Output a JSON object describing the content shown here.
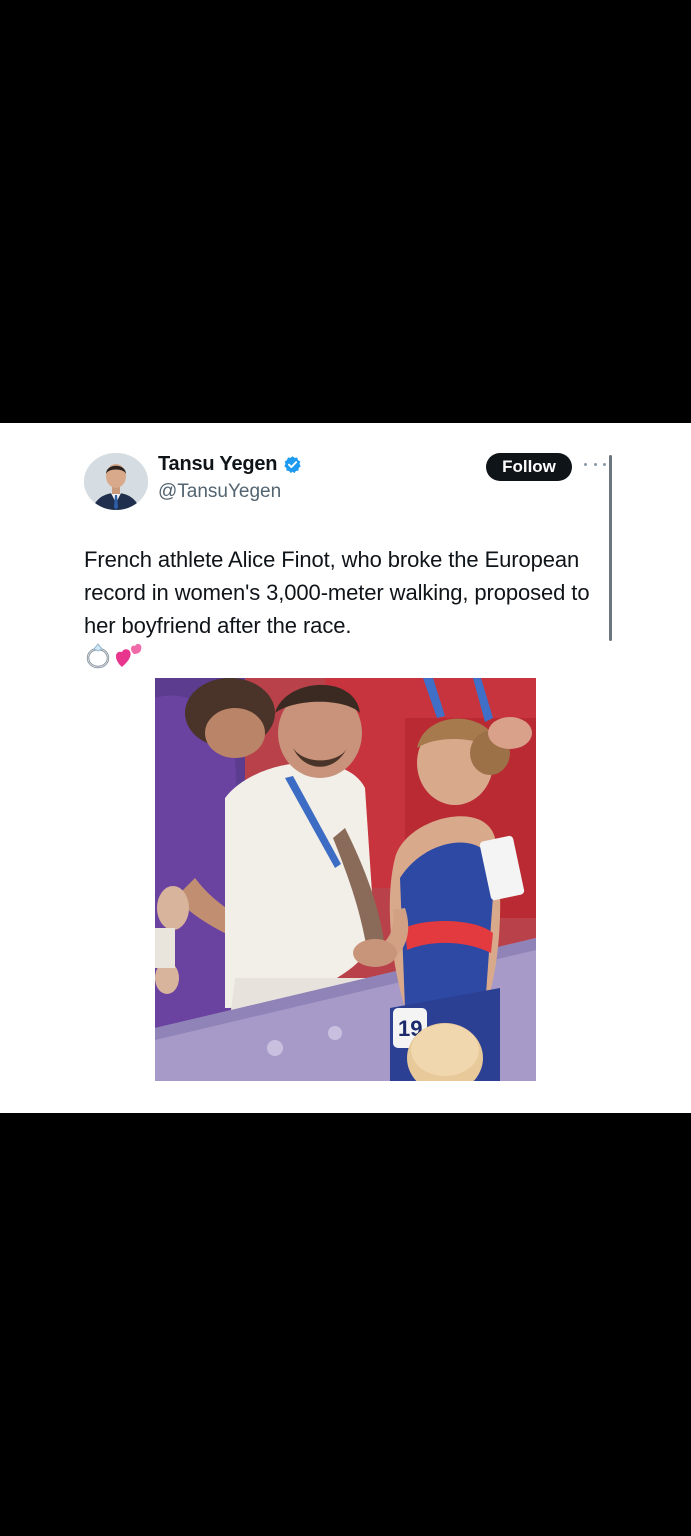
{
  "tweet": {
    "author": {
      "display_name": "Tansu Yegen",
      "handle": "@TansuYegen",
      "verified": true
    },
    "follow_label": "Follow",
    "text": "French athlete Alice Finot, who broke the European record in women's 3,000-meter walking, proposed to her boyfriend after the race.",
    "emojis": [
      "ring-icon",
      "two-hearts-icon"
    ],
    "media": {
      "type": "photo",
      "bib_number_visible": "19"
    }
  },
  "colors": {
    "background": "#000000",
    "card": "#ffffff",
    "text_primary": "#0f1419",
    "text_secondary": "#536471",
    "verified_blue": "#1d9bf0",
    "follow_bg": "#0f1419"
  }
}
